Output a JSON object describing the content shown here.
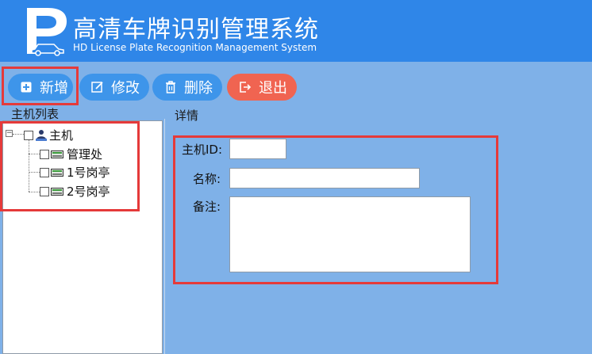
{
  "header": {
    "title_cn": "高清车牌识别管理系统",
    "title_en": "HD License Plate Recognition Management System",
    "logo_letter": "P"
  },
  "toolbar": {
    "add_label": "新增",
    "edit_label": "修改",
    "delete_label": "删除",
    "exit_label": "退出"
  },
  "tree": {
    "title": "主机列表",
    "root_label": "主机",
    "children": [
      "管理处",
      "1号岗亭",
      "2号岗亭"
    ]
  },
  "detail": {
    "title": "详情",
    "host_id_label": "主机ID:",
    "host_id_value": "",
    "name_label": "名称:",
    "name_value": "",
    "remark_label": "备注:",
    "remark_value": ""
  },
  "colors": {
    "header_bg": "#2f86e8",
    "body_bg": "#7fb1e8",
    "button_blue": "#3e95ea",
    "button_red": "#f06451",
    "highlight_red": "#e53a3a"
  }
}
